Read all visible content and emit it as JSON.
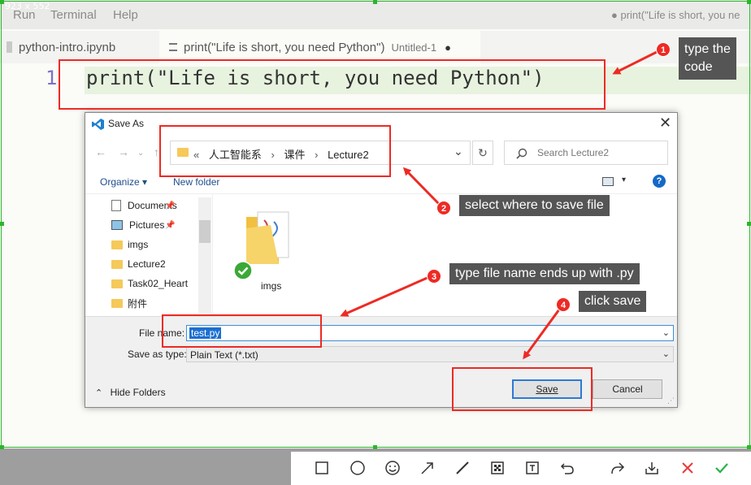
{
  "screenshot": {
    "size_label": "923 x 552"
  },
  "menubar": {
    "items": [
      "Run",
      "Terminal",
      "Help"
    ],
    "window_title": "● print(\"Life is short, you ne"
  },
  "tabs": [
    {
      "label": "python-intro.ipynb"
    },
    {
      "label": "print(\"Life is short, you need Python\")",
      "secondary": "Untitled-1",
      "dirty": "●"
    }
  ],
  "editor": {
    "line_number": "1",
    "code": "print(\"Life is short, you need Python\")"
  },
  "dialog": {
    "title": "Save As",
    "breadcrumb": {
      "prefix": "«",
      "items": [
        "人工智能系",
        "课件",
        "Lecture2"
      ]
    },
    "search_placeholder": "Search Lecture2",
    "organize": "Organize ▾",
    "new_folder": "New folder",
    "nav_items": [
      {
        "label": "Documents",
        "pinned": true
      },
      {
        "label": "Pictures",
        "pinned": true
      },
      {
        "label": "imgs"
      },
      {
        "label": "Lecture2"
      },
      {
        "label": "Task02_Heart"
      },
      {
        "label": "附件"
      }
    ],
    "folder_item": "imgs",
    "file_name_label": "File name:",
    "file_name_value": "test.py",
    "save_type_label": "Save as type:",
    "save_type_value": "Plain Text (*.txt)",
    "hide_folders": "Hide Folders",
    "save_button": "Save",
    "cancel_button": "Cancel"
  },
  "annotations": [
    {
      "number": "1",
      "text_line1": "type the",
      "text_line2": "code"
    },
    {
      "number": "2",
      "text": "select where to save file"
    },
    {
      "number": "3",
      "text": "type file name ends up with .py"
    },
    {
      "number": "4",
      "text": "click save"
    }
  ],
  "colors": {
    "annotation_red": "#ee2a24",
    "callout_bg": "#555555",
    "selection_green": "#2db52d",
    "accent_blue": "#2c7ad6"
  },
  "bottom_toolbar_icons": [
    "rectangle-icon",
    "ellipse-icon",
    "emoji-icon",
    "arrow-icon",
    "pen-icon",
    "mosaic-icon",
    "text-icon",
    "undo-icon",
    "share-icon",
    "download-icon",
    "cancel-icon",
    "confirm-icon"
  ]
}
